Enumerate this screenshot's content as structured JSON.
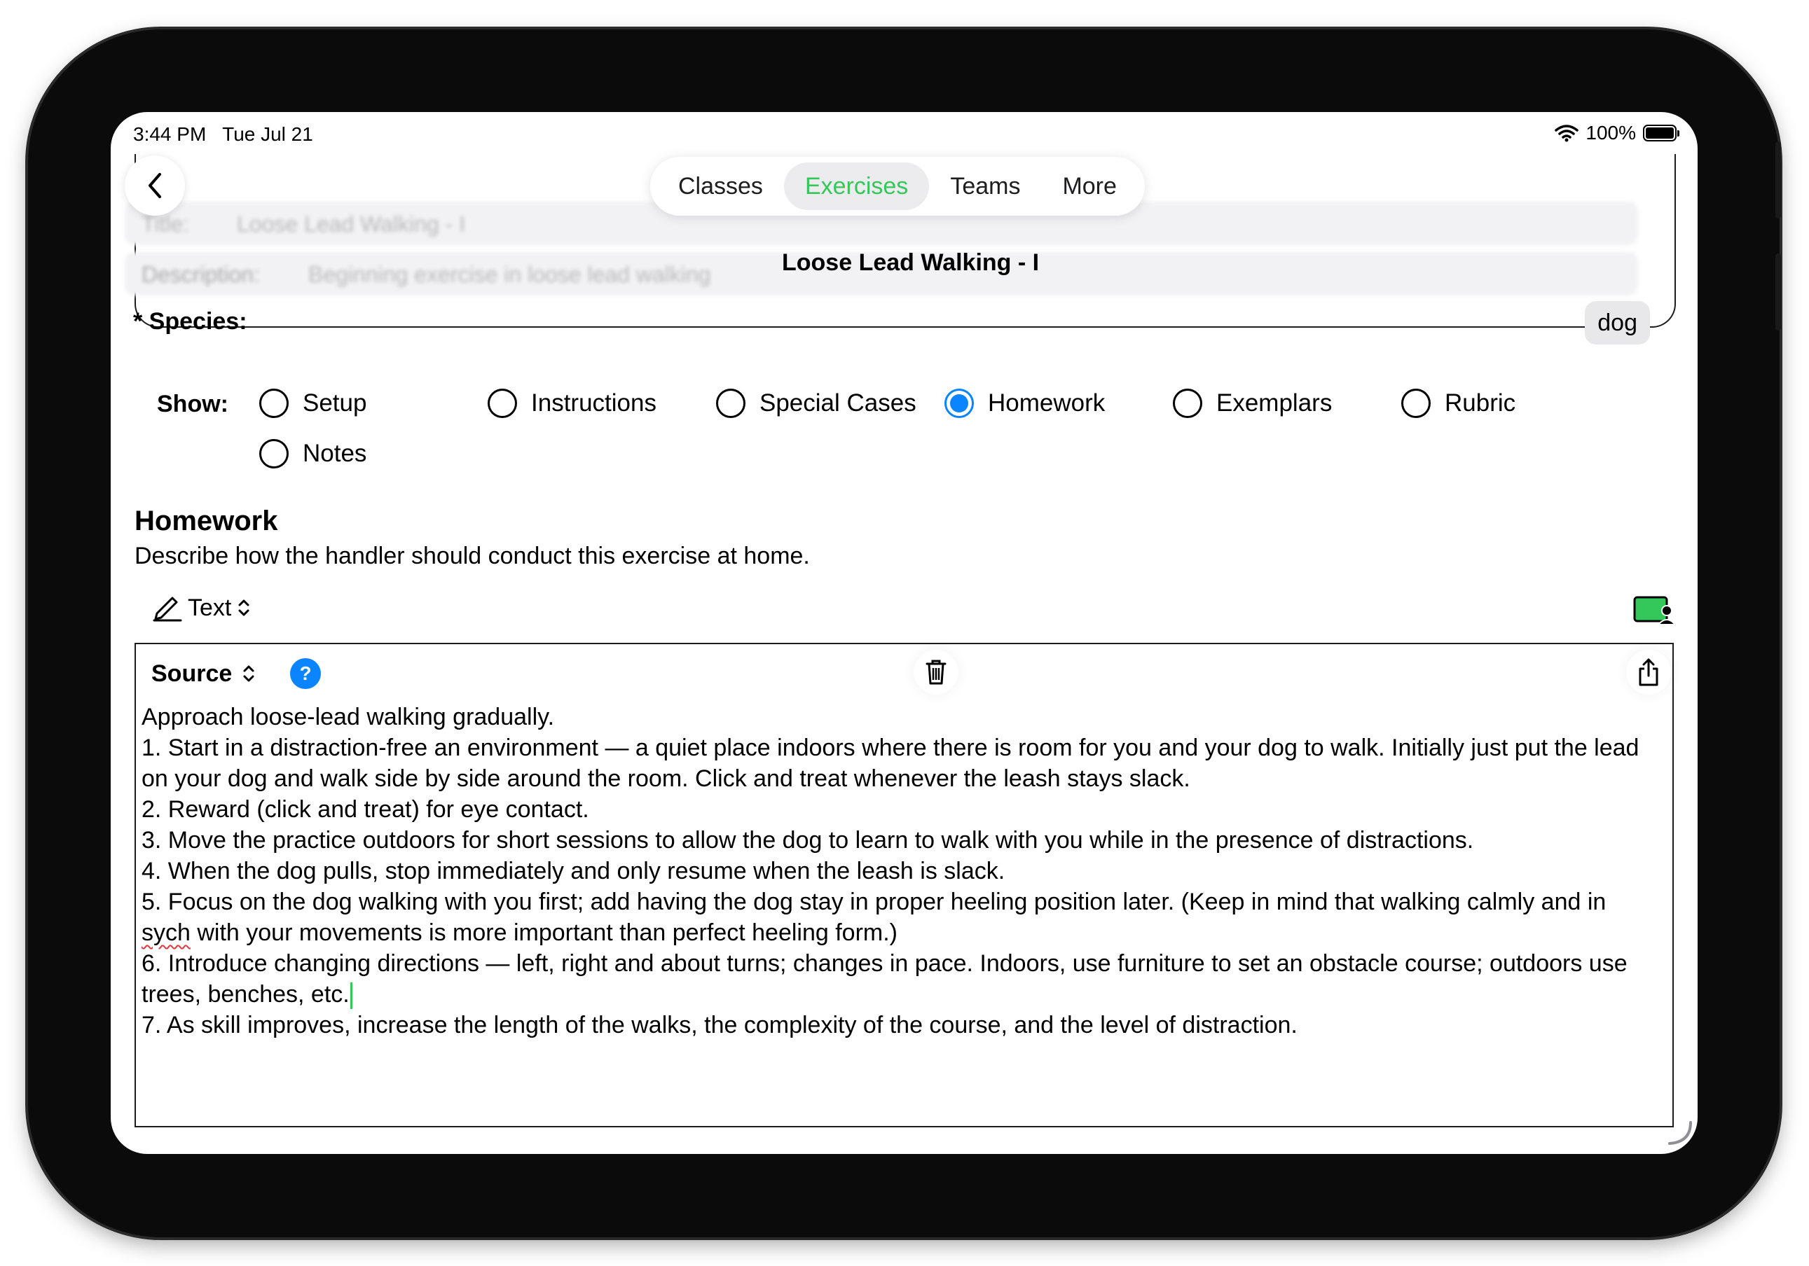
{
  "status": {
    "time": "3:44 PM",
    "date": "Tue Jul 21",
    "battery": "100%"
  },
  "nav": {
    "tabs": [
      {
        "label": "Classes",
        "active": false
      },
      {
        "label": "Exercises",
        "active": true
      },
      {
        "label": "Teams",
        "active": false
      },
      {
        "label": "More",
        "active": false
      }
    ],
    "accent_color": "#34c759"
  },
  "exercise": {
    "title_label": "Title:",
    "title_value": "Loose Lead Walking - I",
    "description_label": "Description:",
    "description_value": "Beginning exercise in loose lead walking",
    "header_title": "Loose Lead Walking - I",
    "species_label": "* Species:",
    "species_value": "dog"
  },
  "show": {
    "label": "Show:",
    "options": [
      {
        "label": "Setup",
        "selected": false
      },
      {
        "label": "Instructions",
        "selected": false
      },
      {
        "label": "Special Cases",
        "selected": false
      },
      {
        "label": "Homework",
        "selected": true
      },
      {
        "label": "Exemplars",
        "selected": false
      },
      {
        "label": "Rubric",
        "selected": false
      },
      {
        "label": "Notes",
        "selected": false
      }
    ]
  },
  "homework": {
    "title": "Homework",
    "subtitle": "Describe how the handler should conduct this exercise at home.",
    "mode_label": "Text",
    "source_label": "Source",
    "help_symbol": "?",
    "lines": [
      "Approach loose-lead walking gradually.",
      "1. Start in a distraction-free an environment — a quiet place indoors where there is room for you and your dog to walk. Initially just put the lead on your dog and walk side by side around the room. Click and treat whenever the leash stays slack.",
      "2. Reward (click and treat) for eye contact.",
      "3. Move the practice outdoors for short sessions to allow the dog to learn to walk with you while in the presence of distractions.",
      "4. When the dog pulls, stop immediately and only resume when the leash is slack.",
      "5. Focus on the dog walking with you first; add having the dog stay in proper heeling position later. (Keep in mind that walking calmly and in",
      "sych",
      " with your movements is more important than perfect heeling form.)",
      "6. Introduce changing directions — left, right and about turns; changes in pace. Indoors, use furniture to set an obstacle course; outdoors use trees, benches, etc.",
      "7. As skill improves, increase the length of the walks, the complexity of the course, and the level of distraction."
    ]
  },
  "icons": {
    "back": "chevron-left-icon",
    "wifi": "wifi-icon",
    "battery": "battery-icon",
    "pencil": "pencil-icon",
    "chevron_updown": "chevron-updown-icon",
    "assign": "assign-person-icon",
    "help": "help-icon",
    "trash": "trash-icon",
    "share": "share-icon",
    "resize": "resize-handle-icon"
  },
  "colors": {
    "selected_radio": "#0a84ff",
    "help": "#0a84ff",
    "accent": "#34c759"
  }
}
